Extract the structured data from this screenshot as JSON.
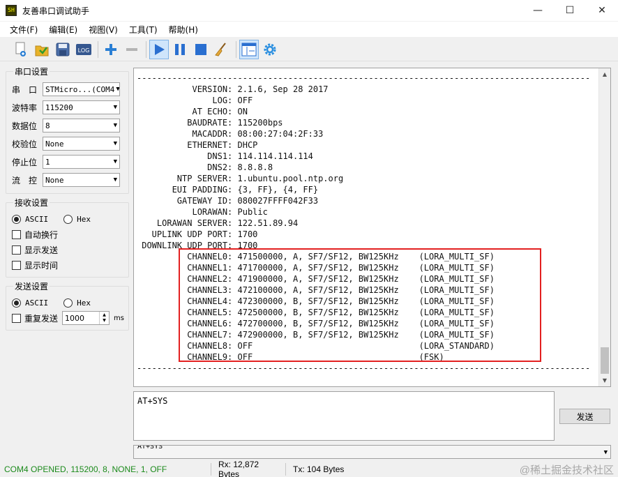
{
  "window": {
    "app_icon_text": "SH",
    "title": "友善串口调试助手",
    "minimize": "—",
    "maximize": "☐",
    "close": "✕"
  },
  "menu": [
    "文件(F)",
    "编辑(E)",
    "视图(V)",
    "工具(T)",
    "帮助(H)"
  ],
  "toolbar": {
    "icons": [
      "new-file-icon",
      "open-folder-icon",
      "save-icon",
      "log-icon",
      "add-icon",
      "remove-icon",
      "play-icon",
      "pause-icon",
      "stop-icon",
      "clear-broom-icon",
      "layout-icon",
      "settings-gear-icon"
    ],
    "log_label": "LOG"
  },
  "serial_settings": {
    "title": "串口设置",
    "port_label": "串　口",
    "port_value": "STMicro...(COM4",
    "baud_label": "波特率",
    "baud_value": "115200",
    "data_bits_label": "数据位",
    "data_bits_value": "8",
    "parity_label": "校验位",
    "parity_value": "None",
    "stop_bits_label": "停止位",
    "stop_bits_value": "1",
    "flow_label": "流　控",
    "flow_value": "None"
  },
  "receive_settings": {
    "title": "接收设置",
    "ascii": "ASCII",
    "hex": "Hex",
    "auto_wrap": "自动换行",
    "show_send": "显示发送",
    "show_time": "显示时间"
  },
  "send_settings": {
    "title": "发送设置",
    "ascii": "ASCII",
    "hex": "Hex",
    "repeat": "重复发送",
    "interval": "1000",
    "unit": "ms"
  },
  "output": {
    "top_partial": " ---- --",
    "lines": [
      "------------------------------------------------------------------------------------------",
      "           VERSION: 2.1.6, Sep 28 2017",
      "               LOG: OFF",
      "           AT ECHO: ON",
      "          BAUDRATE: 115200bps",
      "           MACADDR: 08:00:27:04:2F:33",
      "          ETHERNET: DHCP",
      "              DNS1: 114.114.114.114",
      "              DNS2: 8.8.8.8",
      "        NTP SERVER: 1.ubuntu.pool.ntp.org",
      "       EUI PADDING: {3, FF}, {4, FF}",
      "        GATEWAY ID: 080027FFFF042F33",
      "           LORAWAN: Public",
      "    LORAWAN SERVER: 122.51.89.94",
      "   UPLINK UDP PORT: 1700",
      " DOWNLINK UDP PORT: 1700",
      "          CHANNEL0: 471500000, A, SF7/SF12, BW125KHz    (LORA_MULTI_SF)",
      "          CHANNEL1: 471700000, A, SF7/SF12, BW125KHz    (LORA_MULTI_SF)",
      "          CHANNEL2: 471900000, A, SF7/SF12, BW125KHz    (LORA_MULTI_SF)",
      "          CHANNEL3: 472100000, A, SF7/SF12, BW125KHz    (LORA_MULTI_SF)",
      "          CHANNEL4: 472300000, B, SF7/SF12, BW125KHz    (LORA_MULTI_SF)",
      "          CHANNEL5: 472500000, B, SF7/SF12, BW125KHz    (LORA_MULTI_SF)",
      "          CHANNEL6: 472700000, B, SF7/SF12, BW125KHz    (LORA_MULTI_SF)",
      "          CHANNEL7: 472900000, B, SF7/SF12, BW125KHz    (LORA_MULTI_SF)",
      "          CHANNEL8: OFF                                 (LORA_STANDARD)",
      "          CHANNEL9: OFF                                 (FSK)",
      "------------------------------------------------------------------------------------------"
    ]
  },
  "send_input": "AT+SYS",
  "send_button": "发送",
  "history_value": "AT+SYS",
  "status": {
    "port_status": "COM4 OPENED, 115200, 8, NONE, 1, OFF",
    "rx": "Rx: 12,872 Bytes",
    "tx": "Tx: 104 Bytes",
    "watermark": "@稀土掘金技术社区",
    "status_color": "#1b8a1b"
  }
}
